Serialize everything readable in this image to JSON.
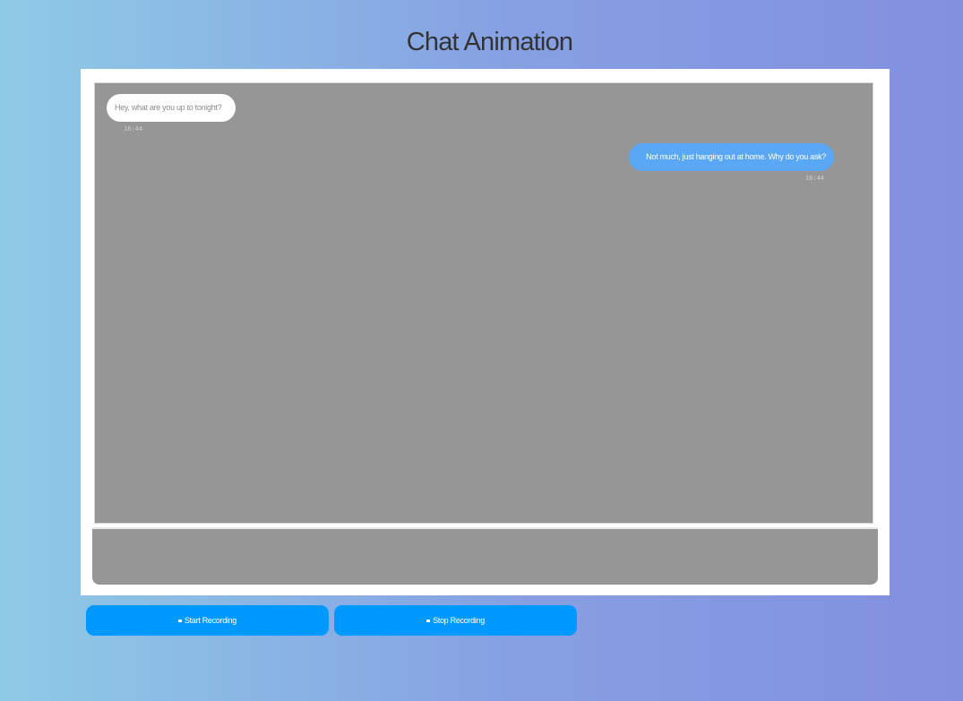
{
  "page": {
    "title": "Chat Animation"
  },
  "chat": {
    "messages": [
      {
        "side": "received",
        "text": "Hey, what are you up to tonight?",
        "time": "16:44"
      },
      {
        "side": "sent",
        "text": "Not much, just hanging out at home. Why do you ask?",
        "time": "16:44"
      }
    ]
  },
  "controls": {
    "start_label": "Start Recording",
    "stop_label": "Stop Recording",
    "start_icon": "record-icon",
    "stop_icon": "stop-icon"
  },
  "colors": {
    "sent_bubble": "#5aa8f5",
    "button": "#0099ff",
    "chat_bg": "#969696"
  }
}
